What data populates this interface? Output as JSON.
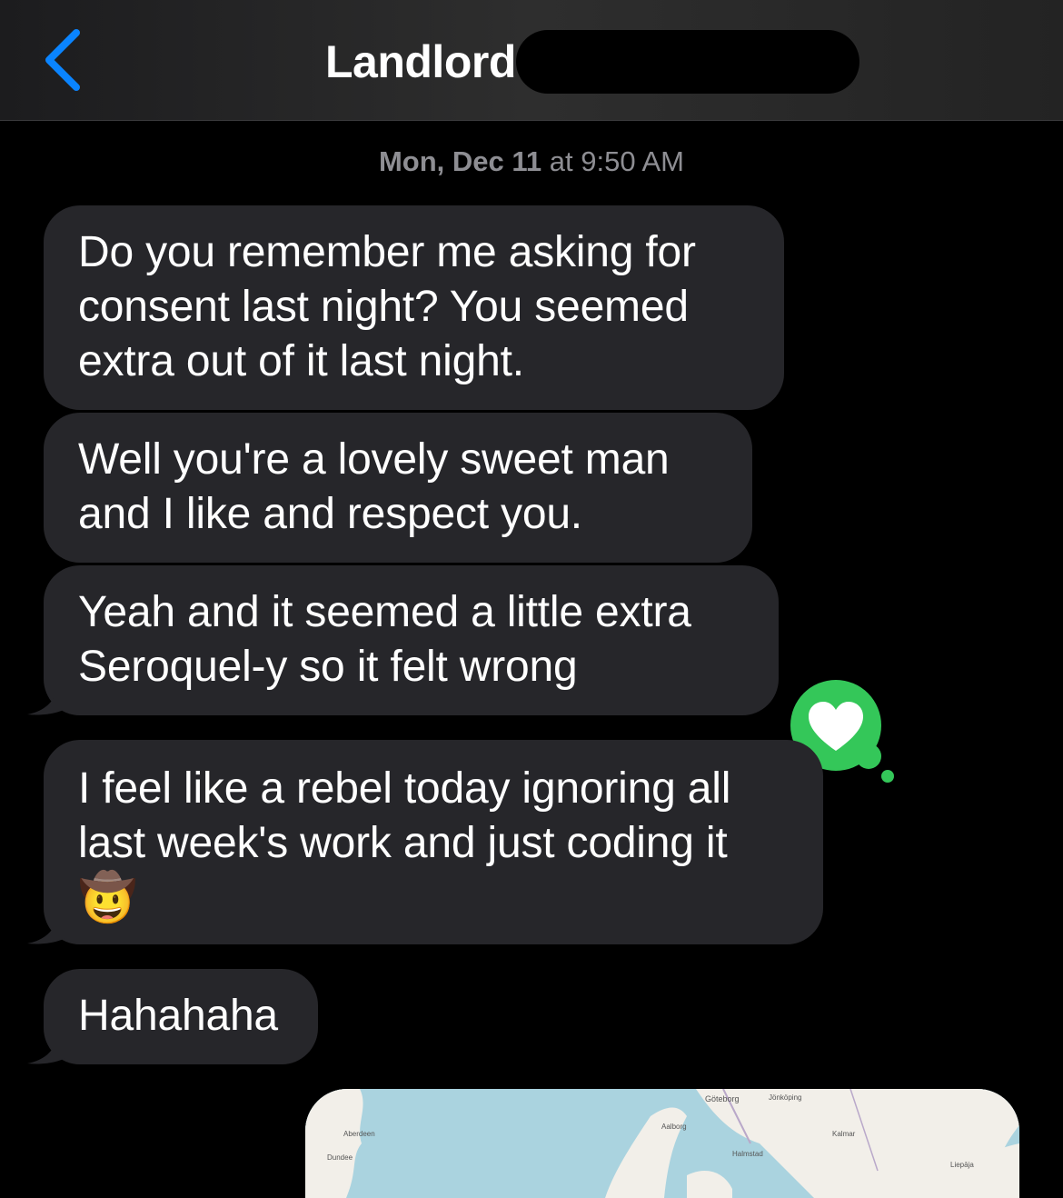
{
  "header": {
    "title": "Landlord",
    "back_icon": "chevron-left-icon",
    "accent_color": "#0a84ff"
  },
  "timestamp": {
    "day": "Mon, Dec 11",
    "at": "at",
    "time": "9:50 AM"
  },
  "messages": [
    {
      "lines": [
        "Do you remember me asking for",
        "consent last night? You seemed",
        "extra out of it last night."
      ]
    },
    {
      "lines": [
        "Well you're a lovely sweet man",
        "and I like and respect you."
      ]
    },
    {
      "lines": [
        "Yeah and it seemed a little extra",
        "Seroquel-y so it felt wrong"
      ]
    },
    {
      "lines": [
        "I feel like a rebel today ignoring all",
        "last week's work and just coding it",
        "🤠"
      ]
    },
    {
      "lines": [
        "Hahahaha"
      ]
    }
  ],
  "reaction": {
    "icon": "heart-icon",
    "color": "#34c759"
  },
  "map": {
    "labels": [
      "Göteborg",
      "Jönköping",
      "Aberdeen",
      "Dundee",
      "Aalborg",
      "Halmstad",
      "Kalmar",
      "Liepāja"
    ]
  },
  "colors": {
    "bubble": "#26262a",
    "background": "#000000",
    "timestamp": "#8e8e93"
  }
}
